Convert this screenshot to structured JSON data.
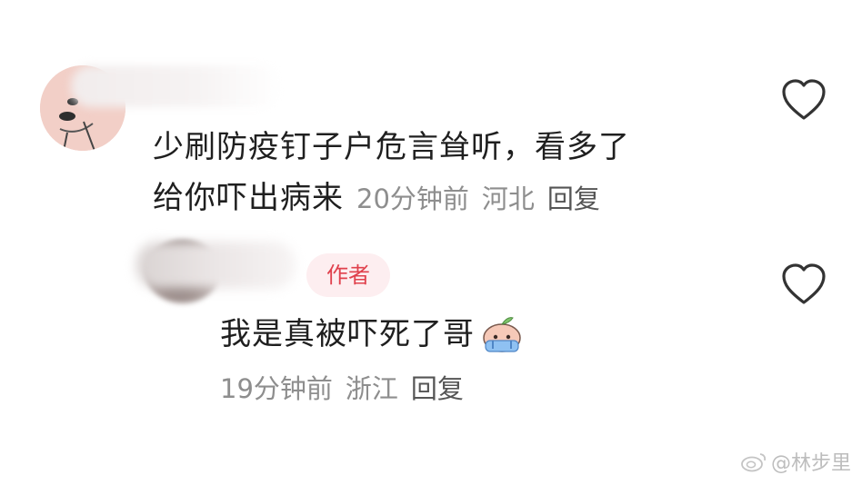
{
  "comments": [
    {
      "text_line1": "少刷防疫钉子户危言耸听，看多了",
      "text_line2": "给你吓出病来",
      "time": "20分钟前",
      "location": "河北",
      "reply_label": "回复"
    },
    {
      "author_badge": "作者",
      "text": "我是真被吓死了哥",
      "time": "19分钟前",
      "location": "浙江",
      "reply_label": "回复"
    }
  ],
  "icons": {
    "like": "heart-outline-icon",
    "sticker": "crying-peach-sticker",
    "watermark_logo": "weibo-logo"
  },
  "watermark": {
    "text": "@林步里"
  },
  "colors": {
    "text": "#1f1f1f",
    "meta": "#8e8e8e",
    "badge_bg": "#fdeef0",
    "badge_text": "#e0414d",
    "icon": "#333333"
  }
}
